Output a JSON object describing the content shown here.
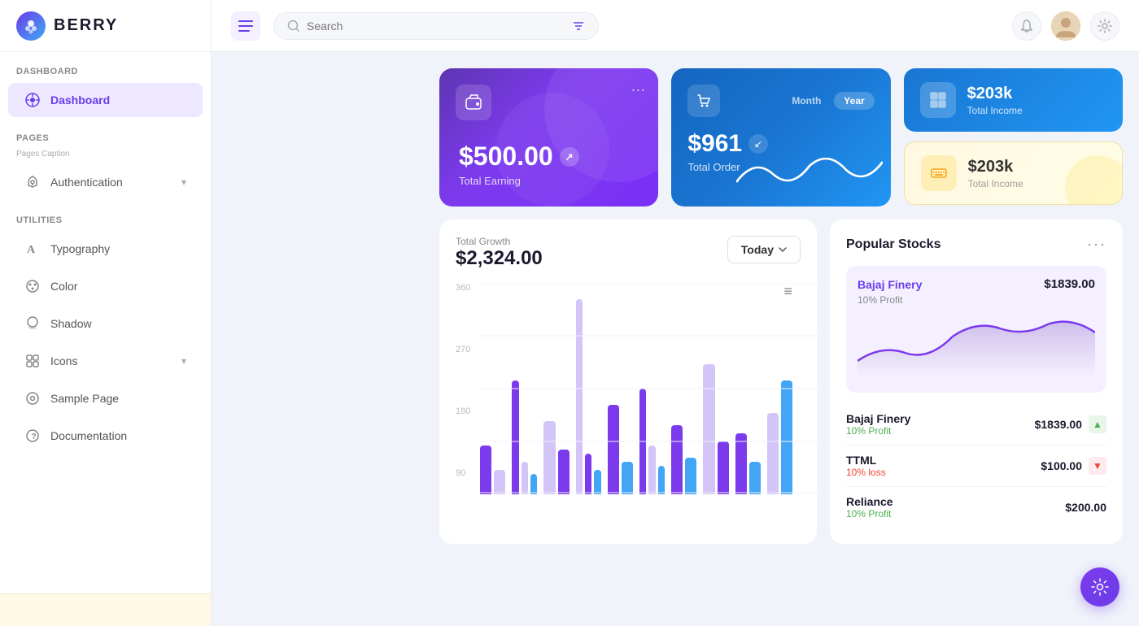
{
  "logo": {
    "text": "BERRY",
    "icon": "🫐"
  },
  "header": {
    "search_placeholder": "Search",
    "hamburger_label": "☰",
    "notification_icon": "🔔",
    "settings_icon": "⚙️"
  },
  "sidebar": {
    "dashboard_section": "Dashboard",
    "dashboard_item": "Dashboard",
    "pages_section": "Pages",
    "pages_caption": "Pages Caption",
    "authentication_item": "Authentication",
    "utilities_section": "Utilities",
    "typography_item": "Typography",
    "color_item": "Color",
    "shadow_item": "Shadow",
    "icons_item": "Icons",
    "sample_page_item": "Sample Page",
    "documentation_item": "Documentation"
  },
  "cards": {
    "total_earning": {
      "amount": "$500.00",
      "label": "Total Earning"
    },
    "total_order": {
      "amount": "$961",
      "label": "Total Order",
      "tab_month": "Month",
      "tab_year": "Year"
    },
    "income_blue": {
      "amount": "$203k",
      "label": "Total Income"
    },
    "income_yellow": {
      "amount": "$203k",
      "label": "Total Income"
    }
  },
  "growth_chart": {
    "label": "Total Growth",
    "amount": "$2,324.00",
    "filter_btn": "Today",
    "y_labels": [
      "360",
      "270",
      "180",
      "90"
    ]
  },
  "stocks": {
    "title": "Popular Stocks",
    "featured": {
      "name": "Bajaj Finery",
      "price": "$1839.00",
      "profit": "10% Profit"
    },
    "rows": [
      {
        "name": "Bajaj Finery",
        "price": "$1839.00",
        "change": "10% Profit",
        "direction": "up"
      },
      {
        "name": "TTML",
        "price": "$100.00",
        "change": "10% loss",
        "direction": "down"
      },
      {
        "name": "Reliance",
        "price": "$200.00",
        "change": "10% Profit",
        "direction": "up"
      }
    ]
  }
}
